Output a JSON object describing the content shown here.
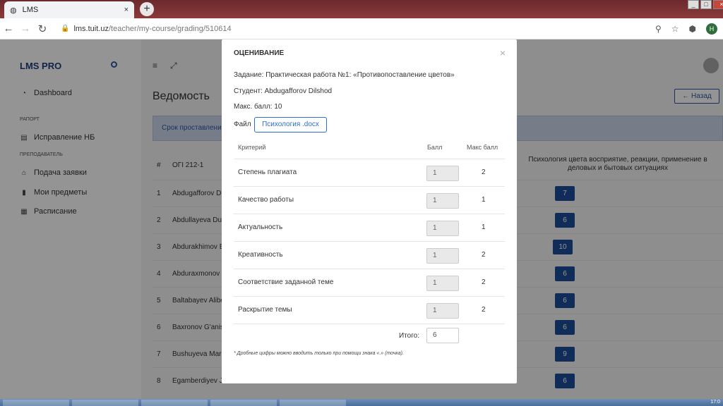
{
  "browser": {
    "tab_title": "LMS",
    "tab_close": "×",
    "new_tab": "+",
    "url_host": "lms.tuit.uz",
    "url_path": "/teacher/my-course/grading/510614",
    "profile_initial": "H"
  },
  "sidebar": {
    "logo": "LMS PRO",
    "dashboard": "Dashboard",
    "section_report": "РАПОРТ",
    "item_nb": "Исправление НБ",
    "section_teacher": "ПРЕПОДАВАТЕЛЬ",
    "item_request": "Подача заявки",
    "item_subjects": "Мои предметы",
    "item_schedule": "Расписание"
  },
  "page": {
    "title": "Ведомость",
    "back_button": "← Назад",
    "alert_text": "Срок проставлени",
    "col_hash": "#",
    "col_group": "ОГI 212-1",
    "col_task": "Психология цвета восприятие, реакции, применение в деловых и бытовых ситуациях",
    "rows": [
      {
        "n": "1",
        "name": "Abdugafforov Di",
        "grade": "7"
      },
      {
        "n": "2",
        "name": "Abdullayeva Du",
        "grade": "6"
      },
      {
        "n": "3",
        "name": "Abdurakhimov B",
        "grade": "10"
      },
      {
        "n": "4",
        "name": "Abduraxmonov",
        "grade": "6"
      },
      {
        "n": "5",
        "name": "Baltabayev Alibe",
        "grade": "6"
      },
      {
        "n": "6",
        "name": "Baxronov G'anis",
        "grade": "6"
      },
      {
        "n": "7",
        "name": "Bushuyeva Mari",
        "grade": "9"
      },
      {
        "n": "8",
        "name": "Egamberdiyev J",
        "grade": "6"
      }
    ]
  },
  "modal": {
    "title": "ОЦЕНИВАНИЕ",
    "close": "×",
    "task": "Задание: Практическая работа №1: «Противопоставление цветов»",
    "student": "Студент: Abdugafforov Dilshod",
    "max_score": "Макс. балл: 10",
    "file_label": "Файл",
    "file_name": "Психология .docx",
    "col_criterion": "Критерий",
    "col_score": "Балл",
    "col_max": "Макс балл",
    "criteria": [
      {
        "name": "Степень плагиата",
        "score": "1",
        "max": "2"
      },
      {
        "name": "Качество работы",
        "score": "1",
        "max": "1"
      },
      {
        "name": "Актуальность",
        "score": "1",
        "max": "1"
      },
      {
        "name": "Креативность",
        "score": "1",
        "max": "2"
      },
      {
        "name": "Соответствие заданной теме",
        "score": "1",
        "max": "2"
      },
      {
        "name": "Раскрытие темы",
        "score": "1",
        "max": "2"
      }
    ],
    "total_label": "Итого:",
    "total_value": "6",
    "note": "* Дробные цифры можно вводить только при помощи знака «.» (точка)."
  },
  "taskbar": {
    "clock": "17:0"
  }
}
